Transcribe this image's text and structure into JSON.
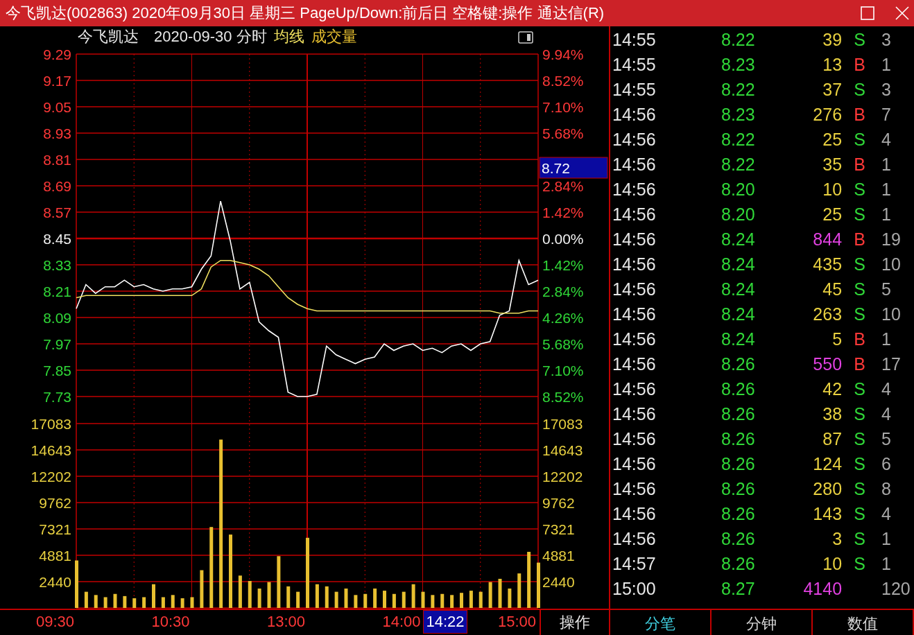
{
  "window": {
    "title": "今飞凯达(002863) 2020年09月30日 星期三 PageUp/Down:前后日 空格键:操作 通达信(R)"
  },
  "header": {
    "stock": "今飞凯达",
    "mode": "2020-09-30 分时"
  },
  "price_chart": {
    "chart_data": {
      "type": "line",
      "series": [
        {
          "color": "#ffffff",
          "values": [
            8.13,
            8.24,
            8.2,
            8.23,
            8.23,
            8.26,
            8.23,
            8.24,
            8.22,
            8.21,
            8.22,
            8.22,
            8.23,
            8.31,
            8.37,
            8.62,
            8.44,
            8.22,
            8.25,
            8.07,
            8.03,
            8.0,
            7.75,
            7.73,
            7.73,
            7.74,
            7.96,
            7.92,
            7.9,
            7.88,
            7.9,
            7.91,
            7.97,
            7.94,
            7.96,
            7.97,
            7.94,
            7.95,
            7.93,
            7.96,
            7.97,
            7.94,
            7.97,
            7.98,
            8.1,
            8.12,
            8.35,
            8.24,
            8.26
          ]
        },
        {
          "name": "均线",
          "color": "#f0e060",
          "values": [
            8.18,
            8.19,
            8.19,
            8.19,
            8.19,
            8.19,
            8.19,
            8.19,
            8.19,
            8.19,
            8.19,
            8.19,
            8.19,
            8.22,
            8.32,
            8.35,
            8.35,
            8.34,
            8.33,
            8.31,
            8.28,
            8.23,
            8.18,
            8.15,
            8.13,
            8.12,
            8.12,
            8.12,
            8.12,
            8.12,
            8.12,
            8.12,
            8.12,
            8.12,
            8.12,
            8.12,
            8.12,
            8.12,
            8.12,
            8.12,
            8.12,
            8.12,
            8.12,
            8.12,
            8.11,
            8.11,
            8.11,
            8.12,
            8.12
          ]
        }
      ],
      "ylim": [
        7.73,
        9.29
      ],
      "y2lim": [
        -8.52,
        9.94
      ],
      "yticks": [
        9.29,
        9.17,
        9.05,
        8.93,
        8.81,
        8.69,
        8.57,
        8.45,
        8.33,
        8.21,
        8.09,
        7.97,
        7.85,
        7.73
      ],
      "y2ticks": [
        {
          "value": 9.94,
          "label": "9.94%"
        },
        {
          "value": 8.52,
          "label": "8.52%"
        },
        {
          "value": 7.1,
          "label": "7.10%"
        },
        {
          "value": 5.68,
          "label": "5.68%"
        },
        {
          "value": 2.84,
          "label": "2.84%"
        },
        {
          "value": 1.42,
          "label": "1.42%"
        },
        {
          "value": 0,
          "label": "0.00%"
        },
        {
          "value": -1.42,
          "label": "1.42%"
        },
        {
          "value": -2.84,
          "label": "2.84%"
        },
        {
          "value": -4.26,
          "label": "4.26%"
        },
        {
          "value": -5.68,
          "label": "5.68%"
        },
        {
          "value": -7.1,
          "label": "7.10%"
        },
        {
          "value": -8.52,
          "label": "8.52%"
        }
      ]
    }
  },
  "volume_chart": {
    "chart_data": {
      "type": "bar",
      "title": "成交量",
      "color": "#e8c030",
      "values": [
        4400,
        1500,
        1200,
        1000,
        1300,
        1100,
        900,
        1000,
        2200,
        1000,
        1200,
        900,
        1000,
        3500,
        7500,
        15600,
        6800,
        3000,
        2500,
        1800,
        2400,
        4800,
        2000,
        1500,
        6500,
        2200,
        2000,
        1500,
        1800,
        1200,
        1300,
        1800,
        1600,
        1300,
        1500,
        2200,
        1500,
        1200,
        1300,
        1200,
        1400,
        1600,
        1500,
        2400,
        2700,
        1800,
        3200,
        5200,
        4200
      ],
      "ylim": [
        0,
        17083
      ],
      "yticks": [
        17083,
        14643,
        12202,
        9762,
        7321,
        4881,
        2440
      ],
      "y2lim": [
        0,
        17083
      ],
      "y2ticks": [
        17083,
        14643,
        12202,
        9762,
        7321,
        4881,
        2440
      ]
    }
  },
  "time_labels": [
    "09:30",
    "10:30",
    "13:00",
    "14:00",
    "15:00"
  ],
  "crosshair": {
    "price": "8.72",
    "time": "14:22"
  },
  "operate_button": "操作",
  "trades": [
    {
      "time": "14:55",
      "price": "8.22",
      "volume": "39",
      "color": "#e8d040",
      "side": "S",
      "kind": "sell",
      "column_5": "3"
    },
    {
      "time": "14:55",
      "price": "8.23",
      "volume": "13",
      "color": "#e8d040",
      "side": "B",
      "kind": "buy",
      "column_5": "1"
    },
    {
      "time": "14:55",
      "price": "8.22",
      "volume": "37",
      "color": "#e8d040",
      "side": "S",
      "kind": "sell",
      "column_5": "3"
    },
    {
      "time": "14:56",
      "price": "8.23",
      "volume": "276",
      "color": "#e8d040",
      "side": "B",
      "kind": "buy",
      "column_5": "7"
    },
    {
      "time": "14:56",
      "price": "8.22",
      "volume": "25",
      "color": "#e8d040",
      "side": "S",
      "kind": "sell",
      "column_5": "4"
    },
    {
      "time": "14:56",
      "price": "8.22",
      "volume": "35",
      "color": "#e8d040",
      "side": "B",
      "kind": "buy",
      "column_5": "1"
    },
    {
      "time": "14:56",
      "price": "8.20",
      "volume": "10",
      "color": "#e8d040",
      "side": "S",
      "kind": "sell",
      "column_5": "1"
    },
    {
      "time": "14:56",
      "price": "8.20",
      "volume": "25",
      "color": "#e8d040",
      "side": "S",
      "kind": "sell",
      "column_5": "1"
    },
    {
      "time": "14:56",
      "price": "8.24",
      "volume": "844",
      "color": "#e040e0",
      "side": "B",
      "kind": "buy",
      "column_5": "19"
    },
    {
      "time": "14:56",
      "price": "8.24",
      "volume": "435",
      "color": "#e8d040",
      "side": "S",
      "kind": "sell",
      "column_5": "10"
    },
    {
      "time": "14:56",
      "price": "8.24",
      "volume": "45",
      "color": "#e8d040",
      "side": "S",
      "kind": "sell",
      "column_5": "5"
    },
    {
      "time": "14:56",
      "price": "8.24",
      "volume": "263",
      "color": "#e8d040",
      "side": "S",
      "kind": "sell",
      "column_5": "10"
    },
    {
      "time": "14:56",
      "price": "8.24",
      "volume": "5",
      "color": "#e8d040",
      "side": "B",
      "kind": "buy",
      "column_5": "1"
    },
    {
      "time": "14:56",
      "price": "8.26",
      "volume": "550",
      "color": "#e040e0",
      "side": "B",
      "kind": "buy",
      "column_5": "17"
    },
    {
      "time": "14:56",
      "price": "8.26",
      "volume": "42",
      "color": "#e8d040",
      "side": "S",
      "kind": "sell",
      "column_5": "4"
    },
    {
      "time": "14:56",
      "price": "8.26",
      "volume": "38",
      "color": "#e8d040",
      "side": "S",
      "kind": "sell",
      "column_5": "4"
    },
    {
      "time": "14:56",
      "price": "8.26",
      "volume": "87",
      "color": "#e8d040",
      "side": "S",
      "kind": "sell",
      "column_5": "5"
    },
    {
      "time": "14:56",
      "price": "8.26",
      "volume": "124",
      "color": "#e8d040",
      "side": "S",
      "kind": "sell",
      "column_5": "6"
    },
    {
      "time": "14:56",
      "price": "8.26",
      "volume": "280",
      "color": "#e8d040",
      "side": "S",
      "kind": "sell",
      "column_5": "8"
    },
    {
      "time": "14:56",
      "price": "8.26",
      "volume": "143",
      "color": "#e8d040",
      "side": "S",
      "kind": "sell",
      "column_5": "4"
    },
    {
      "time": "14:56",
      "price": "8.26",
      "volume": "3",
      "color": "#e8d040",
      "side": "S",
      "kind": "sell",
      "column_5": "1"
    },
    {
      "time": "14:57",
      "price": "8.26",
      "volume": "10",
      "color": "#e8d040",
      "side": "S",
      "kind": "sell",
      "column_5": "1"
    },
    {
      "time": "15:00",
      "price": "8.27",
      "volume": "4140",
      "color": "#e040e0",
      "column_5": "120"
    }
  ],
  "tabs": [
    {
      "label": "分笔",
      "selected": true
    },
    {
      "label": "分钟",
      "selected": false
    },
    {
      "label": "数值",
      "selected": false
    }
  ]
}
